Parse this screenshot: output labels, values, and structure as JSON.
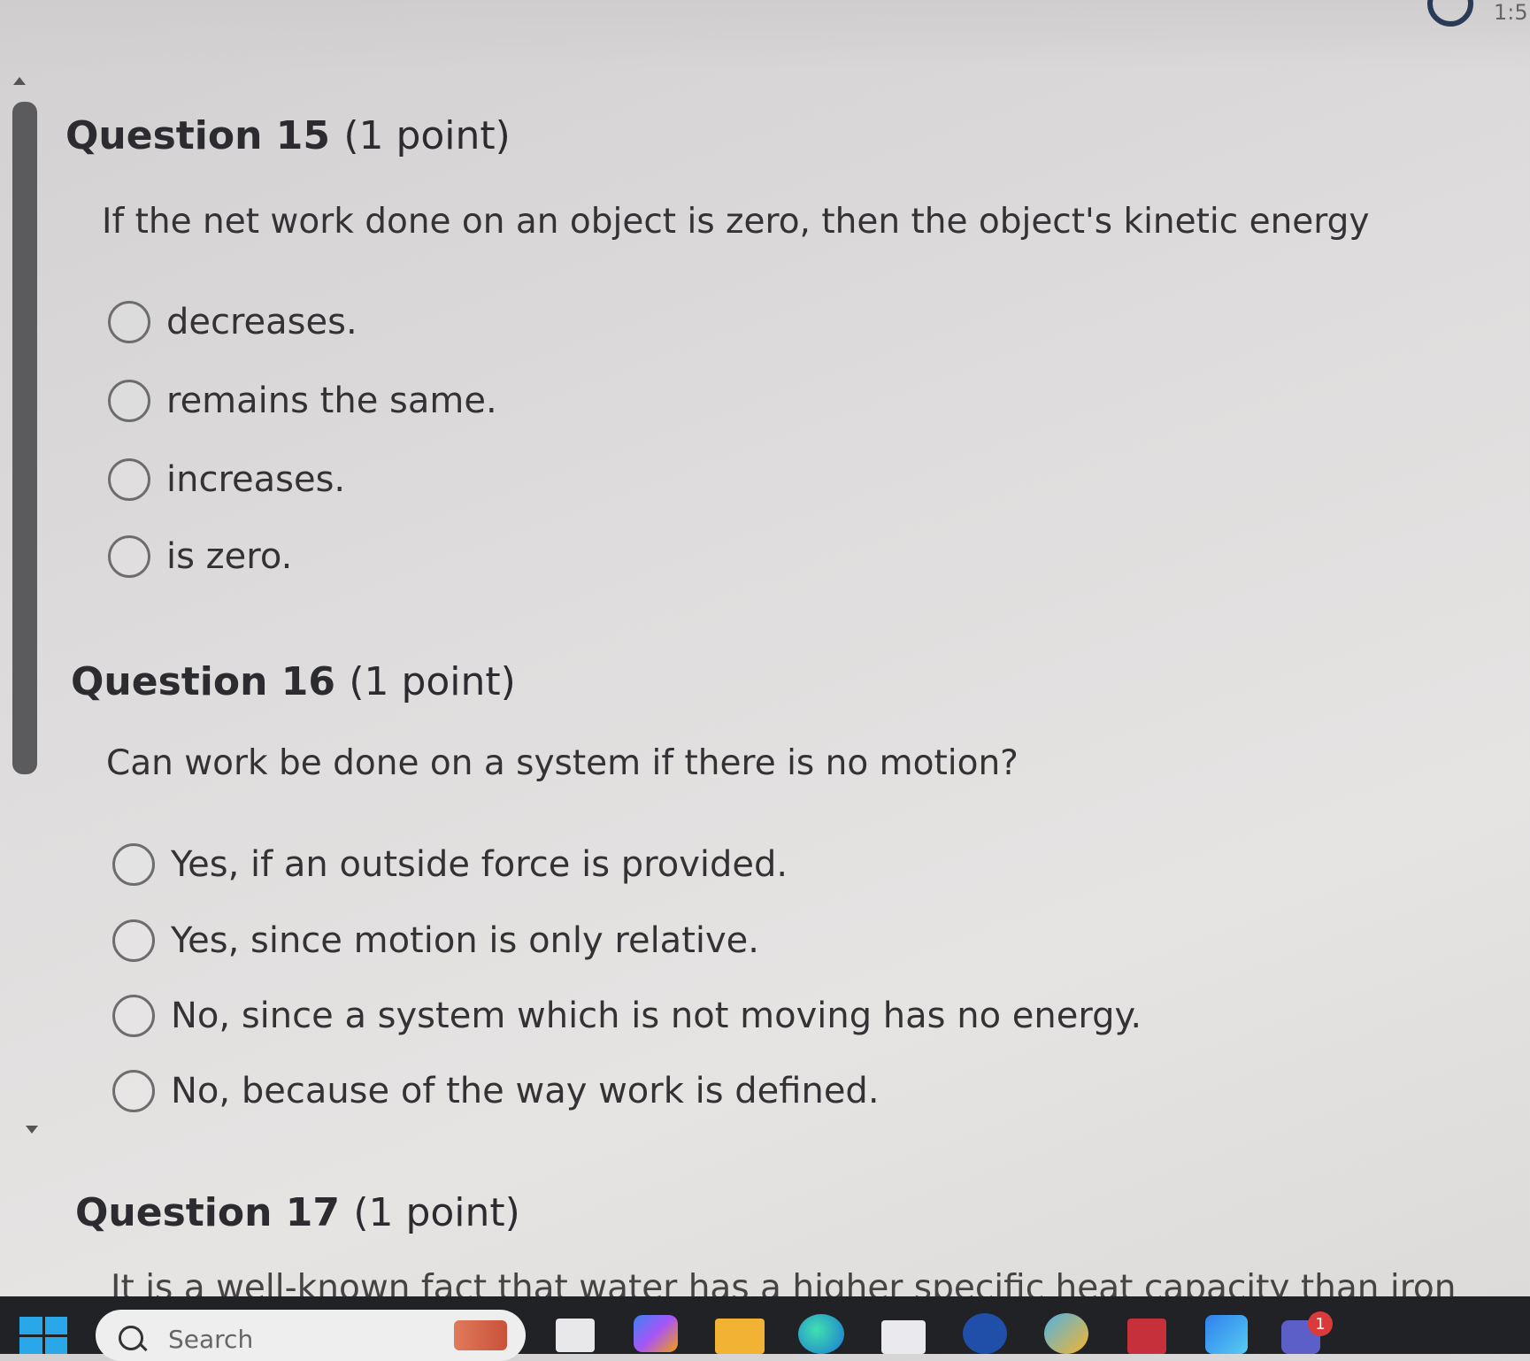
{
  "header": {
    "clock": "1:5"
  },
  "questions": [
    {
      "number": "Question 15",
      "points": "(1 point)",
      "prompt": "If the net work done on an object is zero, then the object's kinetic energy",
      "options": [
        "decreases.",
        "remains the same.",
        "increases.",
        "is zero."
      ]
    },
    {
      "number": "Question 16",
      "points": "(1 point)",
      "prompt": "Can work be done on a system if there is no motion?",
      "options": [
        "Yes, if an outside force is provided.",
        "Yes, since motion is only relative.",
        "No, since a system which is not moving has no energy.",
        "No, because of the way work is defined."
      ]
    },
    {
      "number": "Question 17",
      "points": "(1 point)",
      "prompt": "It is a well-known fact that water has a higher specific heat capacity than iron.  Now"
    }
  ],
  "taskbar": {
    "search_placeholder": "Search",
    "icons": [
      "windows-start-icon",
      "task-view-icon",
      "copilot-icon",
      "file-explorer-icon",
      "edge-icon",
      "store-icon",
      "hp-icon",
      "weather-icon",
      "mcafee-icon",
      "app-icon",
      "teams-icon"
    ],
    "teams_badge": "1",
    "colors": {
      "background": "#202225",
      "start": "#2aa7e8"
    }
  }
}
